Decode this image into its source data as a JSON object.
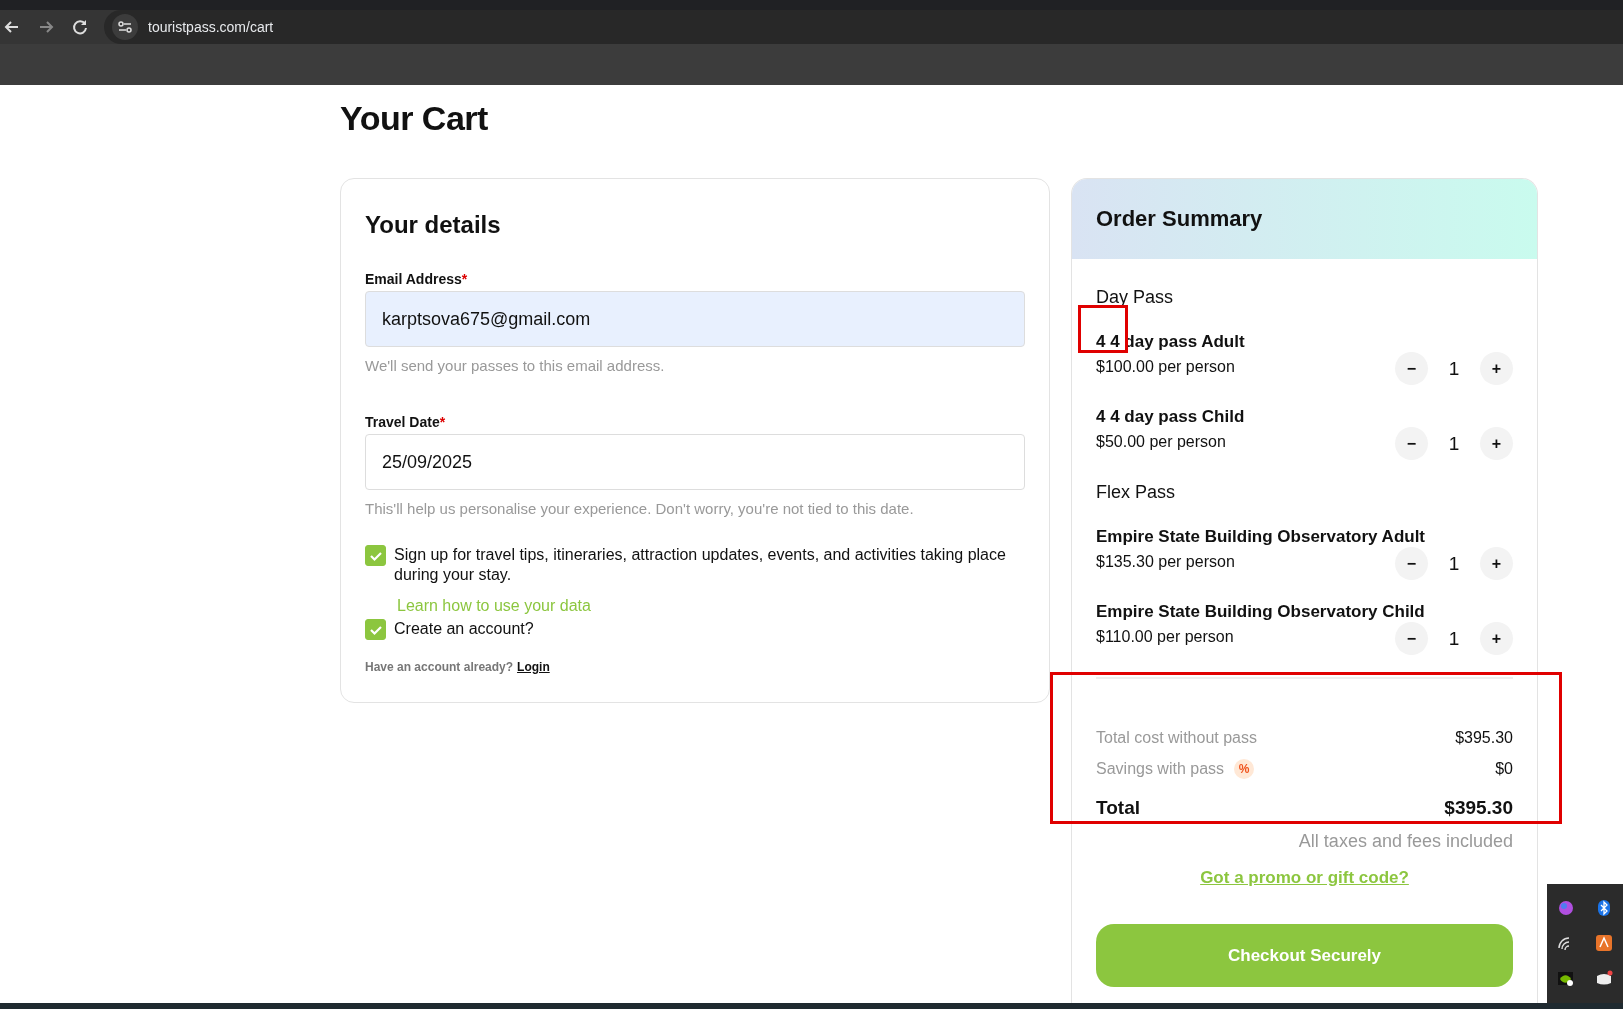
{
  "browser": {
    "url": "touristpass.com/cart"
  },
  "page_title": "Your Cart",
  "details": {
    "title": "Your details",
    "fields": [
      {
        "label": "Email Address",
        "required_mark": "*",
        "value": "karptsova675@gmail.com",
        "hint": "We'll send your passes to this email address.",
        "autofilled": true
      },
      {
        "label": "Travel Date",
        "required_mark": "*",
        "value": "25/09/2025",
        "hint": "This'll help us personalise your experience. Don't worry, you're not tied to this date.",
        "autofilled": false
      }
    ],
    "checkboxes": [
      {
        "label": "Sign up for travel tips, itineraries, attraction updates, events, and activities taking place during your stay.",
        "checked": true,
        "link": "Learn how to use your data"
      },
      {
        "label": "Create an account?",
        "checked": true
      }
    ],
    "login_prompt": "Have an account already?",
    "login_link": "Login"
  },
  "summary": {
    "title": "Order Summary",
    "groups": [
      {
        "name": "Day Pass",
        "items": [
          {
            "name": "4 4 day pass Adult",
            "price": "$100.00 per person",
            "minus": "−",
            "quantity": "1",
            "plus": "+"
          },
          {
            "name": "4 4 day pass Child",
            "price": "$50.00 per person",
            "minus": "−",
            "quantity": "1",
            "plus": "+"
          }
        ]
      },
      {
        "name": "Flex Pass",
        "items": [
          {
            "name": "Empire State Building Observatory Adult",
            "price": "$135.30 per person",
            "minus": "−",
            "quantity": "1",
            "plus": "+"
          },
          {
            "name": "Empire State Building Observatory Child",
            "price": "$110.00 per person",
            "minus": "−",
            "quantity": "1",
            "plus": "+"
          }
        ]
      }
    ],
    "totals": [
      {
        "kind": "plain",
        "label": "Total cost without pass",
        "value": "$395.30"
      },
      {
        "kind": "plain",
        "label": "Savings with pass",
        "badge": "%",
        "value": "$0"
      },
      {
        "kind": "total",
        "label": "Total",
        "value": "$395.30"
      }
    ],
    "taxes_note": "All taxes and fees included",
    "promo_link": "Got a promo or gift code?",
    "checkout_button": "Checkout Securely"
  }
}
